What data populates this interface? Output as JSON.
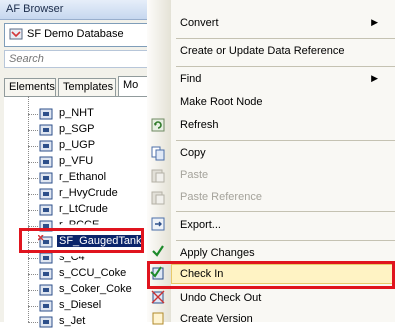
{
  "panel": {
    "title": "AF Browser",
    "database": "SF Demo Database",
    "search_placeholder": "Search",
    "tabs": [
      "Elements",
      "Templates",
      "Mo"
    ]
  },
  "tree": {
    "items": [
      "p_NHT",
      "p_SGP",
      "p_UGP",
      "p_VFU",
      "r_Ethanol",
      "r_HvyCrude",
      "r_LtCrude",
      "r_PCCE",
      "SF_GaugedTank",
      "s_C4",
      "s_CCU_Coke",
      "s_Coker_Coke",
      "s_Diesel",
      "s_Jet"
    ],
    "selected": "SF_GaugedTank"
  },
  "menu": {
    "convert": "Convert",
    "create_ref": "Create or Update Data Reference",
    "find": "Find",
    "make_root": "Make Root Node",
    "refresh": "Refresh",
    "copy": "Copy",
    "paste": "Paste",
    "paste_ref": "Paste Reference",
    "export": "Export...",
    "apply": "Apply Changes",
    "check_in": "Check In",
    "undo_checkout": "Undo Check Out",
    "create_version": "Create Version"
  },
  "colors": {
    "highlight_red": "#e0141e",
    "selection_blue": "#0a246a",
    "menu_hover": "#fff3c4"
  }
}
